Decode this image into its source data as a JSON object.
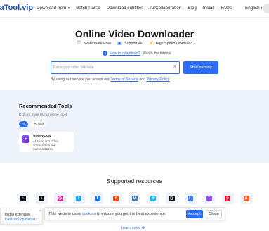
{
  "header": {
    "logo": "taTool.vip",
    "nav": [
      "Download from",
      "Batch Parse",
      "Download subtitles",
      "AdCollaboration",
      "Blog",
      "Install",
      "FAQs"
    ],
    "language": "English"
  },
  "hero": {
    "title": "Online Video Downloader",
    "features": [
      "Watermark Free",
      "Support 4k",
      "High Speed Download"
    ],
    "howto_link": "How to download?",
    "tutorial_text": "Watch the tutorial",
    "input_placeholder": "Paste your video link here",
    "start_button": "Start parsing",
    "terms_prefix": "By using our service you accept our",
    "terms_link": "Terms of Service",
    "terms_and": "and",
    "privacy_link": "Privacy Policy"
  },
  "recommended": {
    "title": "Recommended Tools",
    "subtitle": "Explore more useful online tools",
    "chips": [
      "All",
      "AI tool"
    ],
    "tool": {
      "name": "VideoSeek",
      "description": "AI Audio and Video Transcription and Summarization"
    }
  },
  "supported": {
    "title": "Supported resources",
    "sites": [
      {
        "icon": "tiktok-icon",
        "color": "#111111",
        "glyph": "♪"
      },
      {
        "icon": "tiktok-alt-icon",
        "color": "#111111",
        "glyph": "♪"
      },
      {
        "icon": "instagram-icon",
        "color": "#d6249f",
        "glyph": "◎"
      },
      {
        "icon": "twitter-icon",
        "color": "#1da1f2",
        "glyph": "t"
      },
      {
        "icon": "facebook-icon",
        "color": "#1877f2",
        "glyph": "f"
      },
      {
        "icon": "reddit-icon",
        "color": "#ff4500",
        "glyph": "r"
      },
      {
        "icon": "vk-icon",
        "color": "#4a76a8",
        "glyph": "v"
      },
      {
        "icon": "vimeo-icon",
        "color": "#1ab7ea",
        "glyph": "v"
      },
      {
        "icon": "threads-icon",
        "color": "#111111",
        "glyph": "@"
      },
      {
        "icon": "likee-icon",
        "color": "#3a7bf6",
        "glyph": "L"
      },
      {
        "icon": "twitch-icon",
        "color": "#9146ff",
        "glyph": "T"
      },
      {
        "icon": "pinterest-icon",
        "color": "#e60023",
        "glyph": "p"
      },
      {
        "icon": "kwai-icon",
        "color": "#ff5a1f",
        "glyph": "k"
      }
    ]
  },
  "install_popup": {
    "line1": "Install extension",
    "line2": "DataTool.vip Helper?",
    "close": "×"
  },
  "cookie": {
    "message_prefix": "This website uses",
    "cookies_link": "cookies",
    "message_suffix": "to ensure you get the best experience.",
    "accept": "Accept",
    "close": "Close"
  },
  "learn_more": "Learn more ⊕"
}
